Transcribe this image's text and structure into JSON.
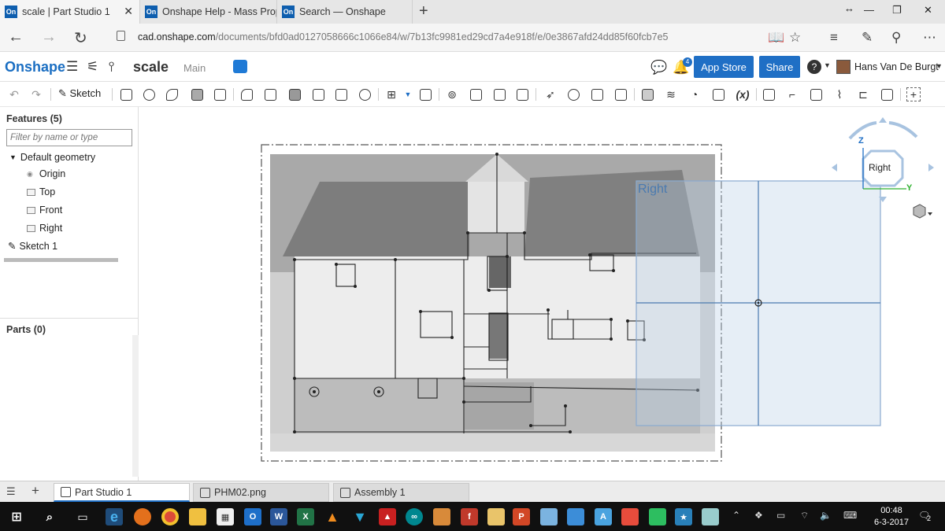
{
  "browser": {
    "tabs": [
      {
        "title": "scale | Part Studio 1",
        "favicon": "On"
      },
      {
        "title": "Onshape Help - Mass Prope",
        "favicon": "On"
      },
      {
        "title": "Search — Onshape",
        "favicon": "On"
      }
    ],
    "url_host": "cad.onshape.com",
    "url_path": "/documents/bfd0ad0127058666c1066e84/w/7b13fc9981ed29cd7a4e918f/e/0e3867afd24dd85f60fcb7e5"
  },
  "app": {
    "logo": "Onshape",
    "document_name": "scale",
    "workspace": "Main",
    "app_store_label": "App Store",
    "share_label": "Share",
    "notification_count": "4",
    "user_name": "Hans Van De Burgt",
    "help_label": "?"
  },
  "toolbar": {
    "sketch_label": "Sketch",
    "variable_label": "(x)"
  },
  "features": {
    "heading": "Features (5)",
    "filter_placeholder": "Filter by name or type",
    "default_geometry": "Default geometry",
    "items": [
      "Origin",
      "Top",
      "Front",
      "Right"
    ],
    "sketch": "Sketch 1",
    "parts_heading": "Parts (0)"
  },
  "viewport": {
    "plane_label": "Right",
    "viewcube_face": "Right",
    "axis_z": "Z",
    "axis_y": "Y"
  },
  "bottom_tabs": [
    {
      "label": "Part Studio 1"
    },
    {
      "label": "PHM02.png"
    },
    {
      "label": "Assembly 1"
    }
  ],
  "taskbar": {
    "time": "00:48",
    "date": "6-3-2017",
    "notification_count": "2"
  },
  "colors": {
    "accent": "#1f6fc5",
    "plane": "#4a7ab0",
    "taskbar": "#101010"
  }
}
